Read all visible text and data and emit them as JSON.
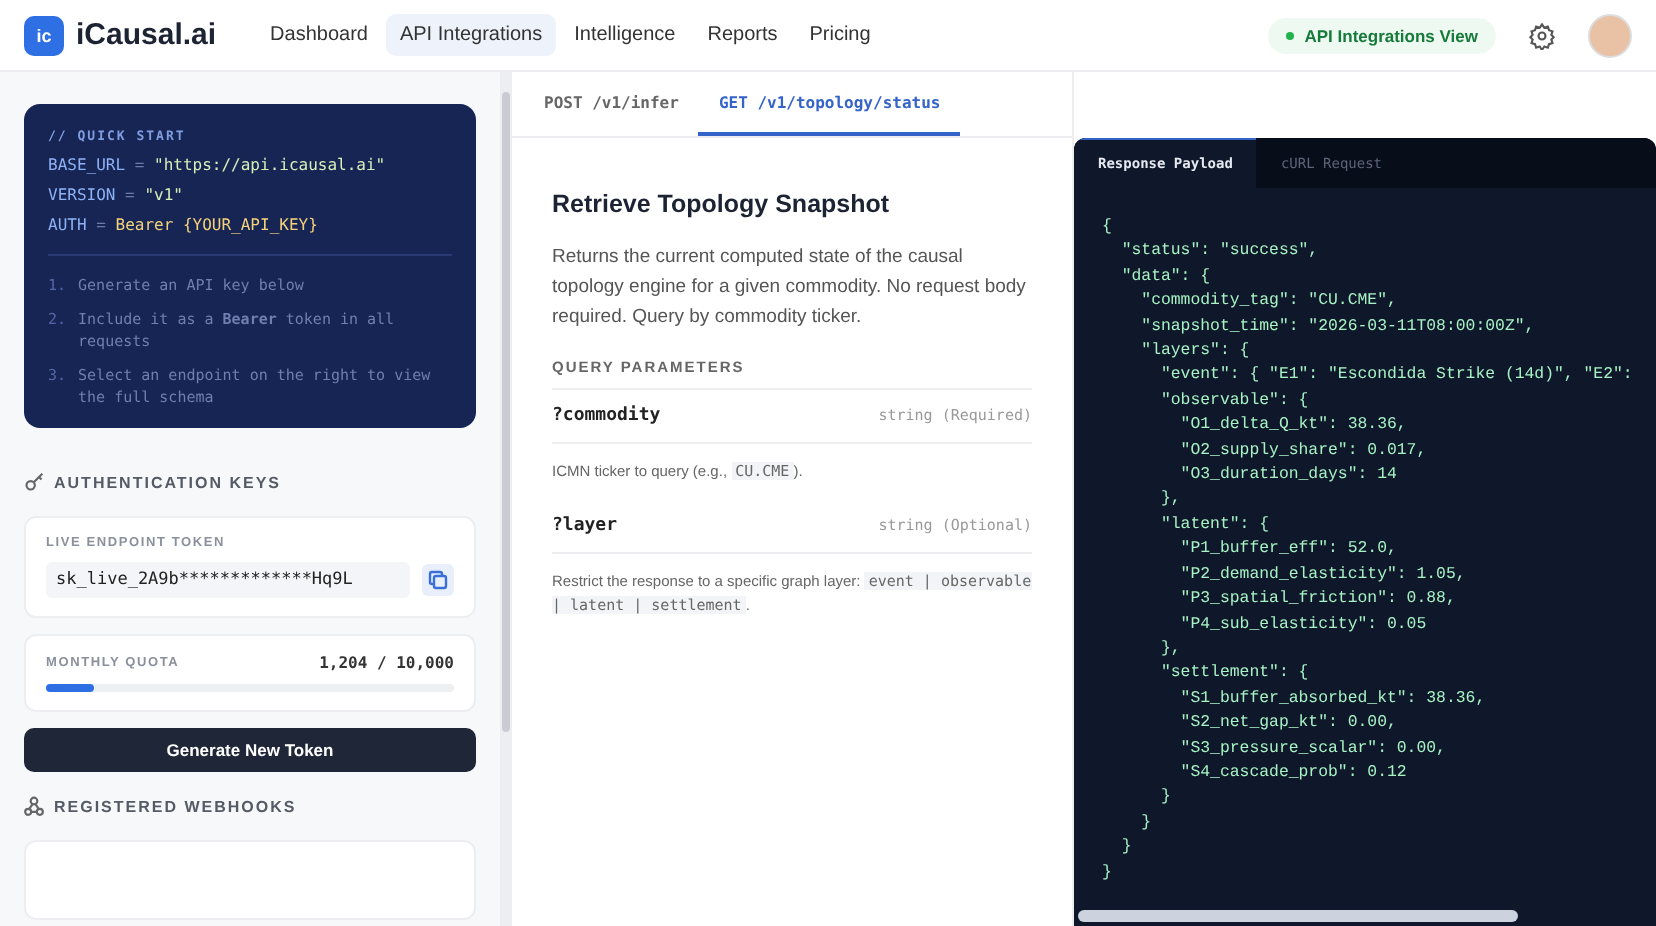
{
  "header": {
    "logo": "ic",
    "brand": "iCausal.ai",
    "nav": [
      {
        "label": "Dashboard",
        "selected": false
      },
      {
        "label": "API Integrations",
        "selected": true
      },
      {
        "label": "Intelligence",
        "selected": false
      },
      {
        "label": "Reports",
        "selected": false
      },
      {
        "label": "Pricing",
        "selected": false
      }
    ],
    "status_badge": "API Integrations View"
  },
  "sidebar": {
    "quick_start": {
      "title": "// QUICK START",
      "config": [
        {
          "key": "BASE_URL",
          "op": "=",
          "value": "\"https://api.icausal.ai\"",
          "kind": "string"
        },
        {
          "key": "VERSION",
          "op": "=",
          "value": "\"v1\"",
          "kind": "string"
        },
        {
          "key": "AUTH",
          "op": "=",
          "value": "Bearer {YOUR_API_KEY}",
          "kind": "token"
        }
      ],
      "steps": [
        {
          "number": "1.",
          "text": "Generate an API key below"
        },
        {
          "number": "2.",
          "text": "Include it as a **Bearer** token in all requests"
        },
        {
          "number": "3.",
          "text": "Select an endpoint on the right to view the full schema"
        }
      ]
    },
    "auth_heading": "AUTHENTICATION KEYS",
    "token": {
      "label": "LIVE ENDPOINT TOKEN",
      "value": "sk_live_2A9b*************Hq9L"
    },
    "quota": {
      "label": "MONTHLY QUOTA",
      "reading": "1,204 / 10,000",
      "level": 0.12
    },
    "generate_button": "Generate New Token",
    "webhooks_heading": "REGISTERED WEBHOOKS"
  },
  "endpoint_tabs": [
    {
      "label": "POST /v1/infer",
      "selected": false
    },
    {
      "label": "GET /v1/topology/status",
      "selected": true
    }
  ],
  "endpoint": {
    "title": "Retrieve Topology Snapshot",
    "description": "Returns the current computed state of the causal topology engine for a given commodity. No request body required. Query by commodity ticker.",
    "params_heading": "QUERY PARAMETERS",
    "params": [
      {
        "name": "?commodity",
        "type": "string (Required)",
        "description": [
          {
            "kind": "text",
            "text": "ICMN ticker to query (e.g., "
          },
          {
            "kind": "code",
            "text": "CU.CME"
          },
          {
            "kind": "text",
            "text": ")."
          }
        ]
      },
      {
        "name": "?layer",
        "type": "string (Optional)",
        "description": [
          {
            "kind": "text",
            "text": "Restrict the response to a specific graph layer: "
          },
          {
            "kind": "code",
            "text": "event | observable | latent | settlement"
          },
          {
            "kind": "text",
            "text": "."
          }
        ]
      }
    ]
  },
  "code_tabs": [
    {
      "label": "Response Payload",
      "selected": true
    },
    {
      "label": "cURL Request",
      "selected": false
    }
  ],
  "payload_lines": [
    "{",
    "  \"status\": \"success\",",
    "  \"data\": {",
    "    \"commodity_tag\": \"CU.CME\",",
    "    \"snapshot_time\": \"2026-03-11T08:00:00Z\",",
    "    \"layers\": {",
    "      \"event\": { \"E1\": \"Escondida Strike (14d)\", \"E2\":",
    "      \"observable\": {",
    "        \"O1_delta_Q_kt\": 38.36,",
    "        \"O2_supply_share\": 0.017,",
    "        \"O3_duration_days\": 14",
    "      },",
    "      \"latent\": {",
    "        \"P1_buffer_eff\": 52.0,",
    "        \"P2_demand_elasticity\": 1.05,",
    "        \"P3_spatial_friction\": 0.88,",
    "        \"P4_sub_elasticity\": 0.05",
    "      },",
    "      \"settlement\": {",
    "        \"S1_buffer_absorbed_kt\": 38.36,",
    "        \"S2_net_gap_kt\": 0.00,",
    "        \"S3_pressure_scalar\": 0.00,",
    "        \"S4_cascade_prob\": 0.12",
    "      }",
    "    }",
    "  }",
    "}"
  ]
}
